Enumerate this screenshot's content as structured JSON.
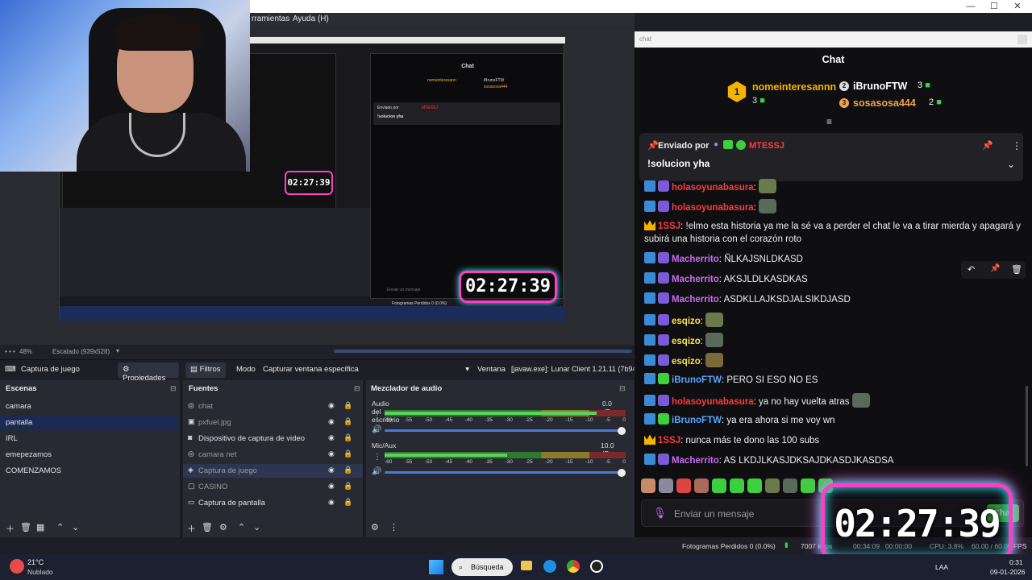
{
  "window": {
    "min": "—",
    "max": "☐",
    "close": "✕"
  },
  "menubar": {
    "items": [
      "rramientas",
      "Ayuda (H)"
    ]
  },
  "webcam": {
    "alt": "streamer"
  },
  "preview": {
    "chat_title": "Chat",
    "chat_top": [
      "nomeinteresann",
      "iBrunoFTW",
      "sosasosa444"
    ],
    "pinned_label": "Enviado por",
    "pinned_user": "MTESSJ",
    "pinned_msg": "!solucion yha",
    "timer": "02:27:39",
    "mini_timer": "02:27:39",
    "input_placeholder": "Enviar un mensaje",
    "status": "Fotogramas Perdidos 0 (0.0%)"
  },
  "zoombar": {
    "zoom": "48%",
    "scaled": "Escalado (939x528)"
  },
  "toolbar": {
    "source_name": "Captura de juego",
    "properties": "Propiedades",
    "filters": "Filtros",
    "mode_label": "Modo",
    "mode_value": "Capturar ventana específica",
    "window_label": "Ventana",
    "window_value": "[javaw.exe]: Lunar Client 1.21.11 (7b94c"
  },
  "scenes": {
    "title": "Escenas",
    "items": [
      "camara",
      "pantalla",
      "IRL",
      "emepezamos",
      "COMENZAMOS"
    ],
    "selected": 1
  },
  "sources": {
    "title": "Fuentes",
    "items": [
      {
        "label": "chat",
        "icon": "browser-icon",
        "dim": true
      },
      {
        "label": "pxfuel.jpg",
        "icon": "image-icon",
        "dim": true
      },
      {
        "label": "Dispositivo de captura de video",
        "icon": "camera-icon",
        "dim": false
      },
      {
        "label": "camara net",
        "icon": "browser-icon",
        "dim": true
      },
      {
        "label": "Captura de juego",
        "icon": "gamepad-icon",
        "dim": true
      },
      {
        "label": "CASINO",
        "icon": "window-icon",
        "dim": true
      },
      {
        "label": "Captura de pantalla",
        "icon": "monitor-icon",
        "dim": false
      }
    ],
    "selected": 4
  },
  "mixer": {
    "title": "Mezclador de audio",
    "channels": [
      {
        "name": "Audio del escritorio",
        "db": "0.0 dB",
        "level": 0.88,
        "volume": 1.0
      },
      {
        "name": "Mic/Aux",
        "db": "10.0 dB",
        "level": 0.51,
        "volume": 1.0
      }
    ],
    "ticks": [
      "-60",
      "-55",
      "-50",
      "-45",
      "-40",
      "-35",
      "-30",
      "-25",
      "-20",
      "-15",
      "-10",
      "-5",
      "0"
    ]
  },
  "chat": {
    "bar_title": "chat",
    "header": "Chat",
    "top": [
      {
        "rank": "1",
        "name": "nomeinteresannn",
        "count": "3",
        "color": "#f5b300"
      },
      {
        "rank": "2",
        "name": "iBrunoFTW",
        "count": "3",
        "color": "#ffffff"
      },
      {
        "rank": "3",
        "name": "sosasosa444",
        "count": "2",
        "color": "#f0a24a"
      }
    ],
    "pinned": {
      "label": "Enviado por",
      "user": "MTESSJ",
      "message": "!solucion yha"
    },
    "messages": [
      {
        "user": "holasoyunabasura",
        "color": "#ff3b3b",
        "text": "",
        "emote": true
      },
      {
        "user": "holasoyunabasura",
        "color": "#ff3b3b",
        "text": "",
        "emote": true
      },
      {
        "user": "1SSJ",
        "color": "#ff3b3b",
        "text": "!elmo esta historia ya me la sé va a perder el chat le va a tirar mierda y apagará y subirá una historia con el corazón roto",
        "emote": false
      },
      {
        "user": "Macherrito",
        "color": "#c86cf0",
        "text": "ÑLKAJSNLDKASD",
        "emote": false
      },
      {
        "user": "Macherrito",
        "color": "#c86cf0",
        "text": "AKSJLDLKASDKAS",
        "emote": false
      },
      {
        "user": "Macherrito",
        "color": "#c86cf0",
        "text": "ASDKLLAJKSDJALSIKDJASD",
        "emote": false
      },
      {
        "user": "esqizo",
        "color": "#ffe14b",
        "text": "",
        "emote": true
      },
      {
        "user": "esqizo",
        "color": "#ffe14b",
        "text": "",
        "emote": true
      },
      {
        "user": "esqizo",
        "color": "#ffe14b",
        "text": "",
        "emote": true
      },
      {
        "user": "iBrunoFTW",
        "color": "#5aa6ff",
        "text": "PERO SI ESO NO ES",
        "emote": false
      },
      {
        "user": "holasoyunabasura",
        "color": "#ff3b3b",
        "text": "ya no hay vuelta atras",
        "emote": true
      },
      {
        "user": "iBrunoFTW",
        "color": "#5aa6ff",
        "text": "ya era ahora si me voy wn",
        "emote": false
      },
      {
        "user": "1SSJ",
        "color": "#ff3b3b",
        "text": "nunca más te dono las 100 subs",
        "emote": false
      },
      {
        "user": "Macherrito",
        "color": "#c86cf0",
        "text": "AS LKDJLKASJDKSAJDKASDJKASDSA",
        "emote": false
      }
    ],
    "input_placeholder": "Enviar un mensaje",
    "send": "Chat"
  },
  "timer": "02:27:39",
  "status": {
    "frames": "Fotogramas Perdidos 0 (0.0%)",
    "kbps": "7007 kbps",
    "time1": "00:34:09",
    "time2": "00:00:00",
    "cpu": "CPU: 3.8%",
    "fps": "60.00 / 60.00 FPS"
  },
  "taskbar": {
    "temp": "21°C",
    "weather": "Nublado",
    "search": "Búsqueda",
    "lang": "LAA",
    "time": "0:31",
    "date": "09-01-2026"
  }
}
